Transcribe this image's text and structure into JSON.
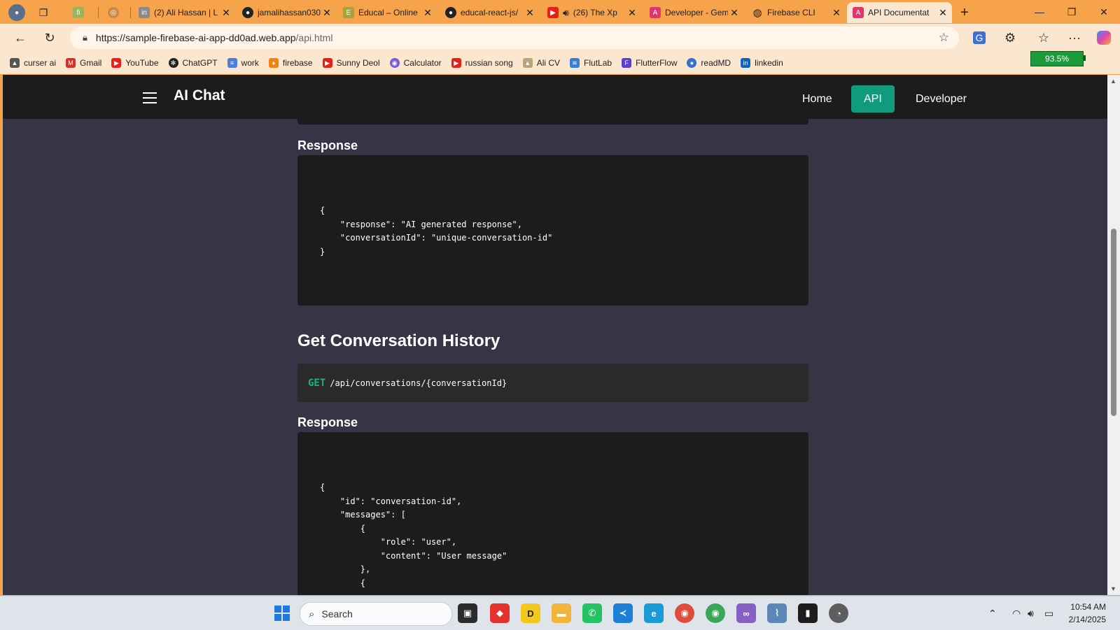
{
  "browser": {
    "tabs": [
      {
        "title": "",
        "favicon": "copilot-icon"
      },
      {
        "title": "",
        "favicon": "pin-icon"
      },
      {
        "title": "",
        "favicon": "fiverr-icon"
      },
      {
        "title": "(2) Ali Hassan | L",
        "favicon": "linkedin-icon"
      },
      {
        "title": "jamalihassan030",
        "favicon": "github-icon"
      },
      {
        "title": "Educal – Online",
        "favicon": "educal-icon"
      },
      {
        "title": "educal-react-js/",
        "favicon": "github-icon"
      },
      {
        "title": "(26) The Xp",
        "favicon": "youtube-icon"
      },
      {
        "title": "Developer - Gem",
        "favicon": "gemini-icon"
      },
      {
        "title": "Firebase CLI",
        "favicon": "globe-icon"
      },
      {
        "title": "API Documentat",
        "favicon": "angular-icon"
      }
    ],
    "url_host": "https://sample-firebase-ai-app-dd0ad.web.app",
    "url_path": "/api.html",
    "battery_label": "93.5%",
    "bookmarks": [
      {
        "label": "curser ai",
        "icon": "cursor-icon"
      },
      {
        "label": "Gmail",
        "icon": "gmail-icon"
      },
      {
        "label": "YouTube",
        "icon": "youtube-icon"
      },
      {
        "label": "ChatGPT",
        "icon": "chatgpt-icon"
      },
      {
        "label": "work",
        "icon": "docs-icon"
      },
      {
        "label": "firebase",
        "icon": "firebase-icon"
      },
      {
        "label": "Sunny Deol",
        "icon": "youtube-icon"
      },
      {
        "label": "Calculator",
        "icon": "calculator-icon"
      },
      {
        "label": "russian song",
        "icon": "youtube-icon"
      },
      {
        "label": "Ali CV",
        "icon": "cv-icon"
      },
      {
        "label": "FlutLab",
        "icon": "flutlab-icon"
      },
      {
        "label": "FlutterFlow",
        "icon": "flutterflow-icon"
      },
      {
        "label": "readMD",
        "icon": "readmd-icon"
      },
      {
        "label": "linkedin",
        "icon": "linkedin-icon"
      }
    ]
  },
  "app": {
    "brand": "AI Chat",
    "nav": {
      "home": "Home",
      "api": "API",
      "developer": "Developer"
    },
    "accent_color": "#119a7d"
  },
  "page": {
    "response1_heading": "Response",
    "response1_code": "{\n    \"response\": \"AI generated response\",\n    \"conversationId\": \"unique-conversation-id\"\n}",
    "section_title": "Get Conversation History",
    "endpoint_method": "GET",
    "endpoint_path": "/api/conversations/{conversationId}",
    "response2_heading": "Response",
    "response2_code": "{\n    \"id\": \"conversation-id\",\n    \"messages\": [\n        {\n            \"role\": \"user\",\n            \"content\": \"User message\"\n        },\n        {"
  },
  "taskbar": {
    "search_placeholder": "Search",
    "time": "10:54 AM",
    "date": "2/14/2025"
  }
}
